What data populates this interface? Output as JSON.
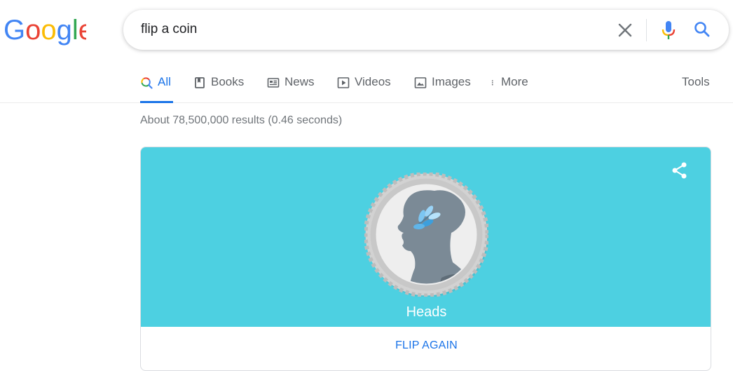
{
  "header": {
    "logo_text": "Google",
    "search": {
      "value": "flip a coin"
    }
  },
  "tabs": [
    {
      "label": "All",
      "icon": "search-multicolor-icon",
      "active": true
    },
    {
      "label": "Books",
      "icon": "book-icon",
      "active": false
    },
    {
      "label": "News",
      "icon": "news-icon",
      "active": false
    },
    {
      "label": "Videos",
      "icon": "play-icon",
      "active": false
    },
    {
      "label": "Images",
      "icon": "image-icon",
      "active": false
    },
    {
      "label": "More",
      "icon": "more-vert-icon",
      "active": false
    }
  ],
  "tools_label": "Tools",
  "result_stats": "About 78,500,000 results (0.46 seconds)",
  "coin_card": {
    "result": "Heads",
    "flip_again_label": "FLIP AGAIN",
    "background_color": "#4dd0e1"
  },
  "colors": {
    "accent": "#1a73e8",
    "google_blue": "#4285f4",
    "google_red": "#ea4335",
    "google_yellow": "#fbbc05",
    "google_green": "#34a853"
  }
}
